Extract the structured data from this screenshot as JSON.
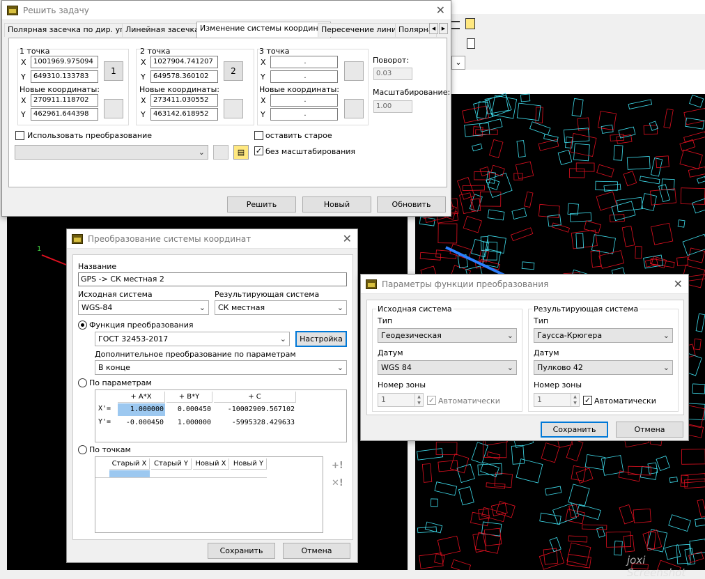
{
  "solve_dialog": {
    "title": "Решить задачу",
    "tabs": [
      "Полярная засечка по дир. углу",
      "Линейная засечка",
      "Изменение системы координат",
      "Пересечение линий",
      "Полярна"
    ],
    "active_tab": 2,
    "point1": {
      "label": "1 точка",
      "x": "1001969.975094",
      "y": "649310.133783",
      "btn": "1"
    },
    "point2": {
      "label": "2 точка",
      "x": "1027904.741207",
      "y": "649578.360102",
      "btn": "2"
    },
    "point3": {
      "label": "3 точка",
      "x": ".",
      "y": "."
    },
    "new_coords_label": "Новые координаты:",
    "new1": {
      "x": "270911.118702",
      "y": "462961.644398"
    },
    "new2": {
      "x": "273411.030552",
      "y": "463142.618952"
    },
    "new3": {
      "x": ".",
      "y": "."
    },
    "x_label": "X",
    "y_label": "Y",
    "rotation_label": "Поворот:",
    "rotation_value": "0.03",
    "scale_label": "Масштабирование:",
    "scale_value": "1.00",
    "use_transform_label": "Использовать преобразование",
    "keep_old_label": "оставить старое",
    "no_scale_label": "без масштабирования",
    "buttons": {
      "solve": "Решить",
      "new": "Новый",
      "update": "Обновить"
    }
  },
  "transform_dialog": {
    "title": "Преобразование системы координат",
    "name_label": "Название",
    "name_value": "GPS -> СК местная 2",
    "source_label": "Исходная система",
    "source_value": "WGS-84",
    "result_label": "Результирующая система",
    "result_value": "СК местная",
    "func_label": "Функция преобразования",
    "func_value": "ГОСТ 32453-2017",
    "settings_btn": "Настройка",
    "extra_label": "Дополнительное преобразование по параметрам",
    "extra_value": "В конце",
    "by_params_label": "По параметрам",
    "params_headers": [
      "+ A*X",
      "+ B*Y",
      "+ C"
    ],
    "params_rows": [
      {
        "name": "X'=",
        "a": "1.000000",
        "b": "0.000450",
        "c": "-10002909.567102"
      },
      {
        "name": "Y'=",
        "a": "-0.000450",
        "b": "1.000000",
        "c": "-5995328.429633"
      }
    ],
    "by_points_label": "По точкам",
    "points_headers": [
      "Старый X",
      "Старый Y",
      "Новый X",
      "Новый Y"
    ],
    "save_btn": "Сохранить",
    "cancel_btn": "Отмена"
  },
  "params_dialog": {
    "title": "Параметры функции преобразования",
    "source": {
      "header": "Исходная система",
      "type_label": "Тип",
      "type_value": "Геодезическая",
      "datum_label": "Датум",
      "datum_value": "WGS 84",
      "zone_label": "Номер зоны",
      "zone_value": "1",
      "auto_label": "Автоматически"
    },
    "result": {
      "header": "Результирующая система",
      "type_label": "Тип",
      "type_value": "Гаусса-Крюгера",
      "datum_label": "Датум",
      "datum_value": "Пулково 42",
      "zone_label": "Номер зоны",
      "zone_value": "1",
      "auto_label": "Автоматически"
    },
    "save_btn": "Сохранить",
    "cancel_btn": "Отмена"
  },
  "background": {
    "map_point_label": "1",
    "watermark": "joxi Screenshot"
  },
  "colors": {
    "map_bg": "#000000",
    "parcel_red": "#e01020",
    "building_cyan": "#40e0f0",
    "line_blue": "#2a7fff",
    "accent": "#0078d7"
  }
}
